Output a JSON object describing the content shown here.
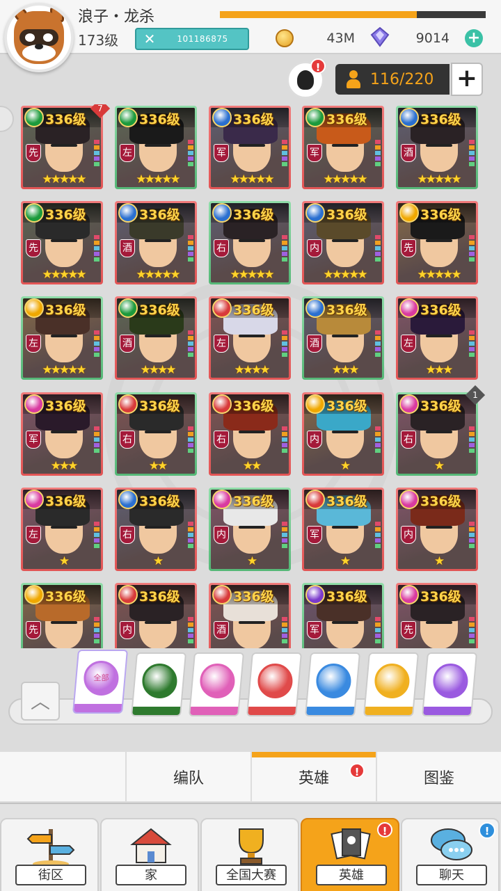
{
  "player": {
    "name": "浪子・龙杀",
    "level": "173级",
    "exp_fraction": 0.74,
    "power": "101186875",
    "gold": "43M",
    "gems": "9014"
  },
  "roster": {
    "capacity": "116/220",
    "skill_alert": "!"
  },
  "heroes": [
    {
      "level": "336级",
      "faction": "green",
      "role": "先",
      "stars": "★★★★★",
      "badge": "7"
    },
    {
      "level": "336级",
      "faction": "green",
      "role": "左",
      "stars": "★★★★★"
    },
    {
      "level": "336级",
      "faction": "blue",
      "role": "军",
      "stars": "★★★★★"
    },
    {
      "level": "336级",
      "faction": "green",
      "role": "军",
      "stars": "★★★★★"
    },
    {
      "level": "336级",
      "faction": "blue",
      "role": "酒",
      "stars": "★★★★★"
    },
    {
      "level": "336级",
      "faction": "green",
      "role": "先",
      "stars": "★★★★★"
    },
    {
      "level": "336级",
      "faction": "blue",
      "role": "酒",
      "stars": "★★★★★"
    },
    {
      "level": "336级",
      "faction": "blue",
      "role": "右",
      "stars": "★★★★★"
    },
    {
      "level": "336级",
      "faction": "blue",
      "role": "内",
      "stars": "★★★★★"
    },
    {
      "level": "336级",
      "faction": "gold",
      "role": "先",
      "stars": "★★★★★"
    },
    {
      "level": "336级",
      "faction": "gold",
      "role": "左",
      "stars": "★★★★★"
    },
    {
      "level": "336级",
      "faction": "green",
      "role": "酒",
      "stars": "★★★★"
    },
    {
      "level": "336级",
      "faction": "red",
      "role": "左",
      "stars": "★★★★"
    },
    {
      "level": "336级",
      "faction": "blue",
      "role": "酒",
      "stars": "★★★"
    },
    {
      "level": "336级",
      "faction": "pink",
      "role": "左",
      "stars": "★★★"
    },
    {
      "level": "336级",
      "faction": "pink",
      "role": "军",
      "stars": "★★★"
    },
    {
      "level": "336级",
      "faction": "red",
      "role": "右",
      "stars": "★★"
    },
    {
      "level": "336级",
      "faction": "red",
      "role": "右",
      "stars": "★★"
    },
    {
      "level": "336级",
      "faction": "gold",
      "role": "内",
      "stars": "★"
    },
    {
      "level": "336级",
      "faction": "pink",
      "role": "右",
      "stars": "★",
      "badge": "1"
    },
    {
      "level": "336级",
      "faction": "pink",
      "role": "左",
      "stars": "★"
    },
    {
      "level": "336级",
      "faction": "blue",
      "role": "右",
      "stars": "★"
    },
    {
      "level": "336级",
      "faction": "pink",
      "role": "内",
      "stars": "★"
    },
    {
      "level": "336级",
      "faction": "red",
      "role": "军",
      "stars": "★"
    },
    {
      "level": "336级",
      "faction": "pink",
      "role": "内",
      "stars": "★"
    },
    {
      "level": "336级",
      "faction": "gold",
      "role": "先",
      "stars": ""
    },
    {
      "level": "336级",
      "faction": "red",
      "role": "内",
      "stars": ""
    },
    {
      "level": "336级",
      "faction": "red",
      "role": "酒",
      "stars": ""
    },
    {
      "level": "336级",
      "faction": "purple",
      "role": "军",
      "stars": ""
    },
    {
      "level": "336级",
      "faction": "pink",
      "role": "先",
      "stars": ""
    }
  ],
  "faction_colors": {
    "green": "#1c9a3c",
    "blue": "#2a6fd0",
    "gold": "#f0a800",
    "red": "#d83a3a",
    "pink": "#d93aa0",
    "purple": "#7a3acc"
  },
  "filters": [
    {
      "id": "all",
      "label": "全部",
      "color": "#c070e0"
    },
    {
      "id": "green",
      "color": "#2e7a2e"
    },
    {
      "id": "pink",
      "color": "#e060b8"
    },
    {
      "id": "red",
      "color": "#e04a4a"
    },
    {
      "id": "blue",
      "color": "#3a8ae0"
    },
    {
      "id": "gold",
      "color": "#f0b020"
    },
    {
      "id": "purple",
      "color": "#9a5ae0"
    }
  ],
  "subtabs": {
    "formation": "编队",
    "heroes": "英雄",
    "heroes_alert": "!",
    "codex": "图鉴"
  },
  "nav": {
    "street": "街区",
    "home": "家",
    "national": "全国大赛",
    "heroes": "英雄",
    "heroes_alert": "!",
    "chat": "聊天",
    "chat_alert": "!"
  }
}
